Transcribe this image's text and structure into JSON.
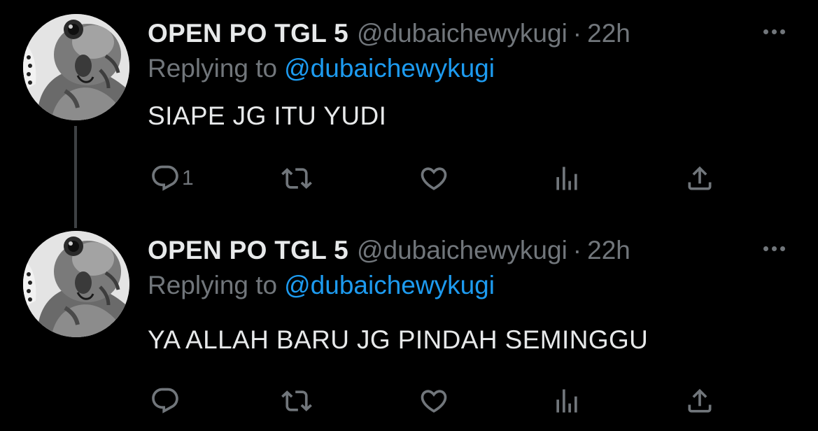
{
  "colors": {
    "background": "#000000",
    "primary_text": "#e7e9ea",
    "secondary_text": "#71767b",
    "link": "#1d9bf0",
    "thread_line": "#3e4144"
  },
  "tweets": [
    {
      "display_name": "OPEN PO TGL 5",
      "handle": "@dubaichewykugi",
      "separator": "·",
      "time": "22h",
      "replying_prefix": "Replying to",
      "replying_to": "@dubaichewykugi",
      "text": "SIAPE JG ITU YUDI",
      "reply_count": "1",
      "icons": [
        "reply-icon",
        "retweet-icon",
        "like-icon",
        "views-icon",
        "share-icon",
        "more-icon"
      ]
    },
    {
      "display_name": "OPEN PO TGL 5",
      "handle": "@dubaichewykugi",
      "separator": "·",
      "time": "22h",
      "replying_prefix": "Replying to",
      "replying_to": "@dubaichewykugi",
      "text": "YA ALLAH BARU JG PINDAH SEMINGGU",
      "reply_count": "",
      "icons": [
        "reply-icon",
        "retweet-icon",
        "like-icon",
        "views-icon",
        "share-icon",
        "more-icon"
      ]
    }
  ]
}
